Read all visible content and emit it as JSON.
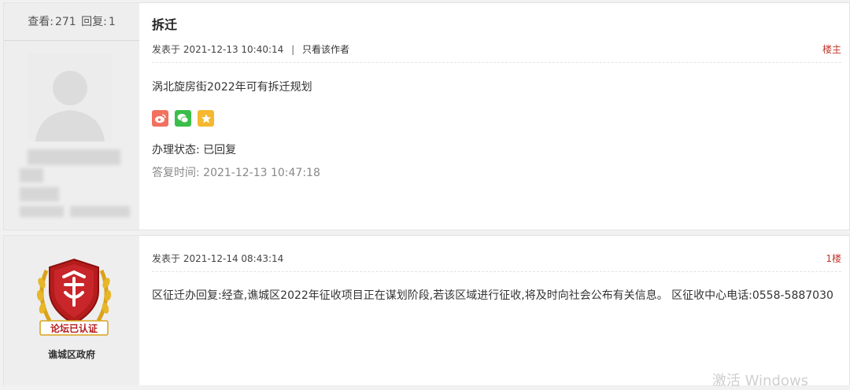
{
  "post1": {
    "stats": {
      "views_label": "查看:",
      "views": "271",
      "replies_label": "回复:",
      "replies": "1"
    },
    "title": "拆迁",
    "posted_label": "发表于",
    "posted_time": "2021-12-13 10:40:14",
    "separator": "|",
    "only_author": "只看该作者",
    "floor": "楼主",
    "body": "涡北旋房街2022年可有拆迁规划",
    "share_icons": [
      "weibo-icon",
      "wechat-icon",
      "favorite-star-icon"
    ],
    "status_label": "办理状态:",
    "status_value": "已回复",
    "reply_time_label": "答复时间:",
    "reply_time_value": "2021-12-13 10:47:18"
  },
  "post2": {
    "posted_label": "发表于",
    "posted_time": "2021-12-14 08:43:14",
    "floor": "1楼",
    "body": "区征迁办回复:经查,谯城区2022年征收项目正在谋划阶段,若该区域进行征收,将及时向社会公布有关信息。 区征收中心电话:0558-5887030",
    "seal_text": "论坛已认证",
    "author": "谯城区政府"
  },
  "watermark": "激活 Windows",
  "colors": {
    "floor": "#c0392b",
    "weibo": "#e6162d",
    "wechat": "#2aae3a",
    "star": "#f5b82e"
  }
}
